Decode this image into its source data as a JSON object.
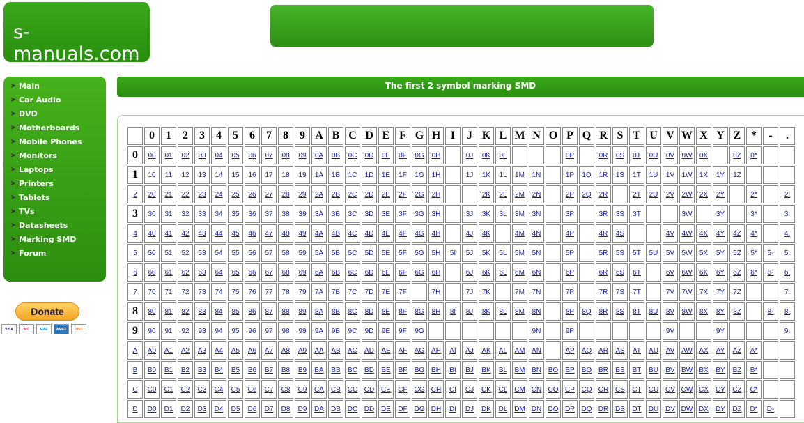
{
  "logo": {
    "text": "s-manuals.com"
  },
  "sidebar": {
    "items": [
      {
        "label": "Main",
        "icon": "arrow-icon"
      },
      {
        "label": "Car Audio",
        "icon": "arrow-icon"
      },
      {
        "label": "DVD",
        "icon": "arrow-icon"
      },
      {
        "label": "Motherboards",
        "icon": "arrow-icon"
      },
      {
        "label": "Mobile Phones",
        "icon": "arrow-icon"
      },
      {
        "label": "Monitors",
        "icon": "arrow-icon"
      },
      {
        "label": "Laptops",
        "icon": "arrow-icon"
      },
      {
        "label": "Printers",
        "icon": "arrow-icon"
      },
      {
        "label": "Tablets",
        "icon": "arrow-icon"
      },
      {
        "label": "TVs",
        "icon": "arrow-icon"
      },
      {
        "label": "Datasheets",
        "icon": "arrow-icon"
      },
      {
        "label": "Marking SMD",
        "icon": "arrow-icon"
      },
      {
        "label": "Forum",
        "icon": "arrow-icon"
      }
    ]
  },
  "donate": {
    "label": "Donate",
    "cards": [
      "VISA",
      "MC",
      "MAE",
      "AMEX",
      "DISC"
    ]
  },
  "main": {
    "title": "The first 2 symbol marking SMD"
  },
  "table": {
    "columns": [
      "",
      "0",
      "1",
      "2",
      "3",
      "4",
      "5",
      "6",
      "7",
      "8",
      "9",
      "A",
      "B",
      "C",
      "D",
      "E",
      "F",
      "G",
      "H",
      "I",
      "J",
      "K",
      "L",
      "M",
      "N",
      "O",
      "P",
      "Q",
      "R",
      "S",
      "T",
      "U",
      "V",
      "W",
      "X",
      "Y",
      "Z",
      "*",
      "-",
      "."
    ],
    "rows": [
      {
        "h": "0",
        "link": false,
        "cells": [
          "00",
          "01",
          "02",
          "03",
          "04",
          "05",
          "06",
          "07",
          "08",
          "09",
          "0A",
          "0B",
          "0C",
          "0D",
          "0E",
          "0F",
          "0G",
          "0H",
          "",
          "0J",
          "0K",
          "0L",
          "",
          "",
          "",
          "0P",
          "",
          "0R",
          "0S",
          "0T",
          "0U",
          "0V",
          "0W",
          "0X",
          "",
          "0Z",
          "0*",
          "",
          ""
        ]
      },
      {
        "h": "1",
        "link": false,
        "cells": [
          "10",
          "11",
          "12",
          "13",
          "14",
          "15",
          "16",
          "17",
          "18",
          "19",
          "1A",
          "1B",
          "1C",
          "1D",
          "1E",
          "1F",
          "1G",
          "1H",
          "",
          "1J",
          "1K",
          "1L",
          "1M",
          "1N",
          "",
          "1P",
          "1Q",
          "1R",
          "1S",
          "1T",
          "1U",
          "1V",
          "1W",
          "1X",
          "1Y",
          "1Z",
          "",
          "",
          ""
        ]
      },
      {
        "h": "2",
        "link": true,
        "cells": [
          "20",
          "21",
          "22",
          "23",
          "24",
          "25",
          "26",
          "27",
          "28",
          "29",
          "2A",
          "2B",
          "2C",
          "2D",
          "2E",
          "2F",
          "2G",
          "2H",
          "",
          "",
          "2K",
          "2L",
          "2M",
          "2N",
          "",
          "2P",
          "2Q",
          "2R",
          "",
          "2T",
          "2U",
          "2V",
          "2W",
          "2X",
          "2Y",
          "",
          "2*",
          "",
          "2."
        ]
      },
      {
        "h": "3",
        "link": false,
        "cells": [
          "30",
          "31",
          "32",
          "33",
          "34",
          "35",
          "36",
          "37",
          "38",
          "39",
          "3A",
          "3B",
          "3C",
          "3D",
          "3E",
          "3F",
          "3G",
          "3H",
          "",
          "3J",
          "3K",
          "3L",
          "3M",
          "3N",
          "",
          "3P",
          "",
          "3R",
          "3S",
          "3T",
          "",
          "",
          "3W",
          "",
          "3Y",
          "",
          "3*",
          "",
          "3."
        ]
      },
      {
        "h": "4",
        "link": true,
        "cells": [
          "40",
          "41",
          "42",
          "43",
          "44",
          "45",
          "46",
          "47",
          "48",
          "49",
          "4A",
          "4B",
          "4C",
          "4D",
          "4E",
          "4F",
          "4G",
          "4H",
          "",
          "4J",
          "4K",
          "",
          "4M",
          "4N",
          "",
          "4P",
          "",
          "4R",
          "4S",
          "",
          "",
          "4V",
          "4W",
          "4X",
          "4Y",
          "4Z",
          "4*",
          "",
          "4."
        ]
      },
      {
        "h": "5",
        "link": true,
        "cells": [
          "50",
          "51",
          "52",
          "53",
          "54",
          "55",
          "56",
          "57",
          "58",
          "59",
          "5A",
          "5B",
          "5C",
          "5D",
          "5E",
          "5F",
          "5G",
          "5H",
          "5I",
          "5J",
          "5K",
          "5L",
          "5M",
          "5N",
          "",
          "5P",
          "",
          "5R",
          "5S",
          "5T",
          "5U",
          "5V",
          "5W",
          "5X",
          "5Y",
          "5Z",
          "5*",
          "5-",
          "5."
        ]
      },
      {
        "h": "6",
        "link": true,
        "cells": [
          "60",
          "61",
          "62",
          "63",
          "64",
          "65",
          "66",
          "67",
          "68",
          "69",
          "6A",
          "6B",
          "6C",
          "6D",
          "6E",
          "6F",
          "6G",
          "6H",
          "",
          "6J",
          "6K",
          "6L",
          "6M",
          "6N",
          "",
          "6P",
          "",
          "6R",
          "6S",
          "6T",
          "",
          "6V",
          "6W",
          "6X",
          "6Y",
          "6Z",
          "6*",
          "6-",
          "6."
        ]
      },
      {
        "h": "7",
        "link": true,
        "cells": [
          "70",
          "71",
          "72",
          "73",
          "74",
          "75",
          "76",
          "77",
          "78",
          "79",
          "7A",
          "7B",
          "7C",
          "7D",
          "7E",
          "7F",
          "",
          "7H",
          "",
          "7J",
          "7K",
          "",
          "7M",
          "7N",
          "",
          "7P",
          "",
          "7R",
          "7S",
          "7T",
          "",
          "7V",
          "7W",
          "7X",
          "7Y",
          "7Z",
          "",
          "",
          "7."
        ]
      },
      {
        "h": "8",
        "link": false,
        "cells": [
          "80",
          "81",
          "82",
          "83",
          "84",
          "85",
          "86",
          "87",
          "88",
          "89",
          "8A",
          "8B",
          "8C",
          "8D",
          "8E",
          "8F",
          "8G",
          "8H",
          "8I",
          "8J",
          "8K",
          "8L",
          "8M",
          "8N",
          "",
          "8P",
          "8Q",
          "8R",
          "8S",
          "8T",
          "8U",
          "8V",
          "8W",
          "8X",
          "8Y",
          "8Z",
          "",
          "8-",
          "8."
        ]
      },
      {
        "h": "9",
        "link": false,
        "cells": [
          "90",
          "91",
          "92",
          "93",
          "94",
          "95",
          "96",
          "97",
          "98",
          "99",
          "9A",
          "9B",
          "9C",
          "9D",
          "9E",
          "9F",
          "9G",
          "",
          "",
          "",
          "",
          "",
          "",
          "9N",
          "",
          "9P",
          "",
          "",
          "",
          "",
          "",
          "9V",
          "",
          "",
          "9Y",
          "",
          "",
          "",
          "9."
        ]
      },
      {
        "h": "A",
        "link": true,
        "cells": [
          "A0",
          "A1",
          "A2",
          "A3",
          "A4",
          "A5",
          "A6",
          "A7",
          "A8",
          "A9",
          "AA",
          "AB",
          "AC",
          "AD",
          "AE",
          "AF",
          "AG",
          "AH",
          "AI",
          "AJ",
          "AK",
          "AL",
          "AM",
          "AN",
          "",
          "AP",
          "AQ",
          "AR",
          "AS",
          "AT",
          "AU",
          "AV",
          "AW",
          "AX",
          "AY",
          "AZ",
          "A*",
          "",
          ""
        ]
      },
      {
        "h": "B",
        "link": true,
        "cells": [
          "B0",
          "B1",
          "B2",
          "B3",
          "B4",
          "B5",
          "B6",
          "B7",
          "B8",
          "B9",
          "BA",
          "BB",
          "BC",
          "BD",
          "BE",
          "BF",
          "BG",
          "BH",
          "BI",
          "BJ",
          "BK",
          "BL",
          "BM",
          "BN",
          "BO",
          "BP",
          "BQ",
          "BR",
          "BS",
          "BT",
          "BU",
          "BV",
          "BW",
          "BX",
          "BY",
          "BZ",
          "B*",
          "",
          ""
        ]
      },
      {
        "h": "C",
        "link": true,
        "cells": [
          "C0",
          "C1",
          "C2",
          "C3",
          "C4",
          "C5",
          "C6",
          "C7",
          "C8",
          "C9",
          "CA",
          "CB",
          "CC",
          "CD",
          "CE",
          "CF",
          "CG",
          "CH",
          "CI",
          "CJ",
          "CK",
          "CL",
          "CM",
          "CN",
          "CO",
          "CP",
          "CQ",
          "CR",
          "CS",
          "CT",
          "CU",
          "CV",
          "CW",
          "CX",
          "CY",
          "CZ",
          "C*",
          "",
          ""
        ]
      },
      {
        "h": "D",
        "link": true,
        "cells": [
          "D0",
          "D1",
          "D2",
          "D3",
          "D4",
          "D5",
          "D6",
          "D7",
          "D8",
          "D9",
          "DA",
          "DB",
          "DC",
          "DD",
          "DE",
          "DF",
          "DG",
          "DH",
          "DI",
          "DJ",
          "DK",
          "DL",
          "DM",
          "DN",
          "DO",
          "DP",
          "DQ",
          "DR",
          "DS",
          "DT",
          "DU",
          "DV",
          "DW",
          "DX",
          "DY",
          "DZ",
          "D*",
          "D-",
          ""
        ]
      }
    ]
  }
}
